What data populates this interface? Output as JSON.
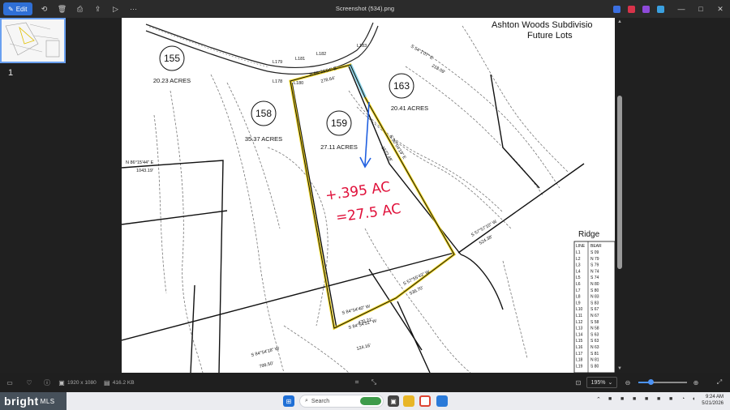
{
  "window": {
    "title": "Screenshot (534).png",
    "edit_label": "Edit",
    "toolbar_icons": [
      "rotate-icon",
      "delete-icon",
      "print-icon",
      "share-icon",
      "slideshow-icon",
      "more-icon"
    ],
    "more_label": "···",
    "min_label": "—",
    "max_label": "□",
    "close_label": "✕"
  },
  "sidebar": {
    "page_number": "1"
  },
  "map": {
    "subdivision_title": "Ashton Woods Subdivisio",
    "subdivision_sub": "Future Lots",
    "lot_155": "155",
    "lot_155_acres": "20.23 ACRES",
    "lot_158": "158",
    "lot_158_acres": "35.37 ACRES",
    "lot_159": "159",
    "lot_159_acres": "27.11 ACRES",
    "lot_163": "163",
    "lot_163_acres": "20.41 ACRES",
    "annotation_line1": "+.395 AC",
    "annotation_line2": "=27.5 AC",
    "ridge_label": "Ridge",
    "bearing_n": "N 86°15'44\" E",
    "bearing_n_dist": "1043.19'",
    "bearing_s1": "S 84°54'40\" W",
    "bearing_s1_dist": "470.21'",
    "bearing_s2": "S 57°55'43\" W",
    "bearing_s2_dist": "536.70'",
    "bearing_s3": "S 57°57'10\" W",
    "bearing_s3_dist": "524.38'",
    "bearing_s4": "S 84°54'51\" W",
    "bearing_s4_dist": "124.16'",
    "bearing_s5": "S 84°54'18\" W",
    "bearing_s5_dist": "799.50'",
    "bearing_top": "N 69°39'04\" E",
    "bearing_top_dist": "278.64'",
    "bearing_ne": "S 54°1'07\" E",
    "bearing_ne_dist": "218.09'",
    "bearing_right": "S 30°04'19\" E",
    "bearing_right_dist": "1572.48'",
    "line_labels": [
      "L179",
      "L181",
      "L182",
      "L180",
      "L178",
      "L183"
    ],
    "table_header": [
      "LINE",
      "BEAR"
    ],
    "table_rows": [
      [
        "L1",
        "S 09"
      ],
      [
        "L2",
        "N 79"
      ],
      [
        "L3",
        "S 79"
      ],
      [
        "L4",
        "N 74"
      ],
      [
        "L5",
        "S 74"
      ],
      [
        "L6",
        "N 80"
      ],
      [
        "L7",
        "S 80"
      ],
      [
        "L8",
        "N 83"
      ],
      [
        "L9",
        "S 83"
      ],
      [
        "L10",
        "S 67"
      ],
      [
        "L11",
        "N 67"
      ],
      [
        "L12",
        "S 58"
      ],
      [
        "L13",
        "N 58"
      ],
      [
        "L14",
        "S 63"
      ],
      [
        "L15",
        "S 63"
      ],
      [
        "L16",
        "N 63"
      ],
      [
        "L17",
        "S 81"
      ],
      [
        "L18",
        "N 81"
      ],
      [
        "L19",
        "S 80"
      ]
    ]
  },
  "status": {
    "dimensions": "1920 x 1080",
    "filesize": "416.2 KB",
    "zoom": "195%",
    "zoom_level": 0.25
  },
  "taskbar": {
    "brand": "bright",
    "brand_sub": "MLS",
    "search_placeholder": "Search",
    "time": "9:24 AM",
    "date": "5/21/2026"
  },
  "colors": {
    "accent": "#2f6fd6",
    "highlight_yellow": "#f0d000",
    "highlight_blue": "#7fd3f5",
    "arrow_blue": "#1f5fe0",
    "annotation_red": "#e0103a"
  }
}
